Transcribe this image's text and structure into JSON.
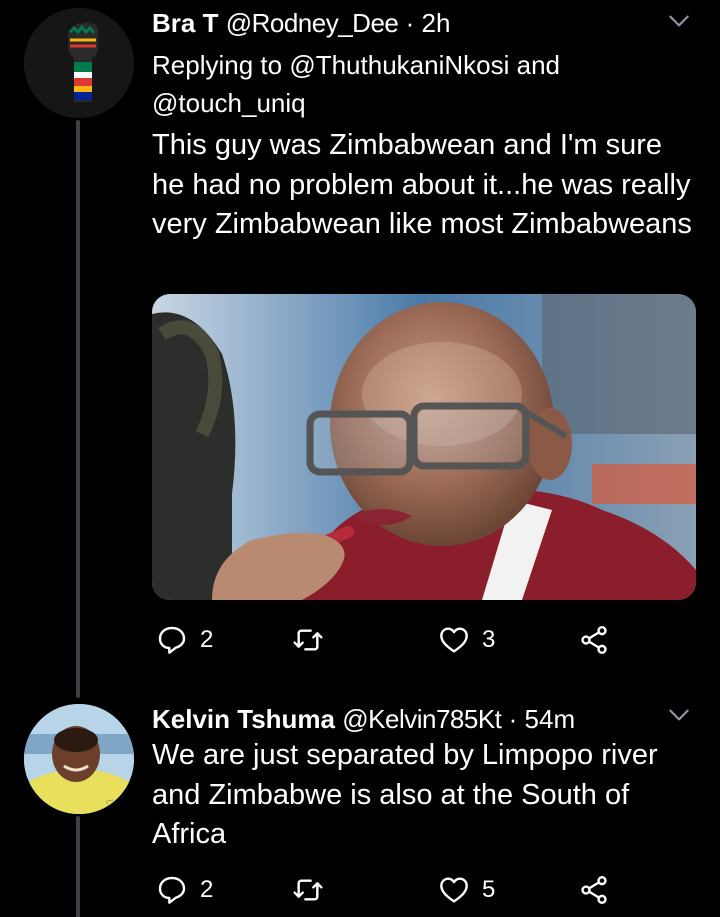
{
  "tweets": [
    {
      "author_name": "Bra T",
      "author_handle": "@Rodney_Dee",
      "separator": "·",
      "time": "2h",
      "replying_prefix": "Replying to",
      "replying_mention_1": "@ThuthukaniNkosi",
      "replying_and": "and",
      "replying_mention_2": "@touch_uniq",
      "text": "This guy was Zimbabwean and I'm sure he had no problem about it...he was really very Zimbabwean like most Zimbabweans",
      "reply_count": "2",
      "retweet_count": "",
      "like_count": "3"
    },
    {
      "author_name": "Kelvin Tshuma",
      "author_handle": "@Kelvin785Kt",
      "separator": "·",
      "time": "54m",
      "text": "We are just separated by Limpopo river and Zimbabwe is also at the South of Africa",
      "reply_count": "2",
      "retweet_count": "",
      "like_count": "5"
    }
  ],
  "icons": [
    "chevron-down-icon",
    "reply-icon",
    "retweet-icon",
    "like-icon",
    "share-icon"
  ],
  "colors": {
    "background": "#000000",
    "text": "#ffffff",
    "thread_line": "#3d4146"
  }
}
